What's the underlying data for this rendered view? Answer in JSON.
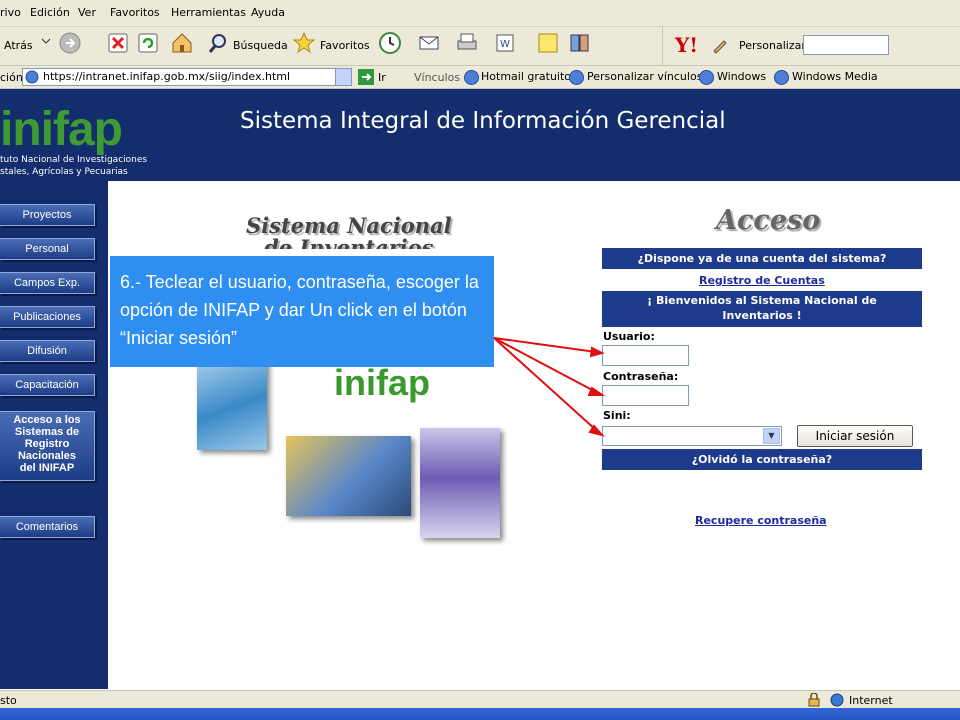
{
  "menu": [
    "rivo",
    "Edición",
    "Ver",
    "Favoritos",
    "Herramientas",
    "Ayuda"
  ],
  "toolbar": {
    "back": "Atrás",
    "search": "Búsqueda",
    "favorites": "Favoritos",
    "yahoo_personalize": "Personalizar"
  },
  "address": {
    "label": "ción",
    "url": "https://intranet.inifap.gob.mx/siig/index.html",
    "go": "Ir"
  },
  "links": {
    "label": "Vínculos",
    "items": [
      "Hotmail gratuito",
      "Personalizar vínculos",
      "Windows",
      "Windows Media"
    ]
  },
  "header": {
    "logo": "inifap",
    "logo_sub1": "tuto Nacional de Investigaciones",
    "logo_sub2": "stales, Agrícolas y Pecuarias",
    "title": "Sistema Integral de Información Gerencial"
  },
  "sidebar": {
    "items": [
      "Proyectos",
      "Personal",
      "Campos Exp.",
      "Publicaciones",
      "Difusión",
      "Capacitación",
      "Acceso a los\nSistemas de\nRegistro\nNacionales\ndel INIFAP",
      "Comentarios"
    ]
  },
  "main": {
    "sn_title_line1": "Sistema Nacional",
    "sn_title_line2": "de Inventarios",
    "collage_logo": "inifap"
  },
  "login": {
    "title": "Acceso",
    "bar_account": "¿Dispone ya de una cuenta del sistema?",
    "register_link": "Registro de Cuentas",
    "welcome": "¡ Bienvenidos al Sistema Nacional de Inventarios !",
    "user_label": "Usuario:",
    "password_label": "Contraseña:",
    "sini_label": "Sini:",
    "submit": "Iniciar sesión",
    "forgot_bar": "¿Olvidó la contraseña?",
    "recover_link": "Recupere contraseña"
  },
  "callout": {
    "text": "6.- Teclear el usuario, contraseña, escoger la opción de INIFAP y dar Un click en el botón “Iniciar sesión”"
  },
  "status": {
    "left": "sto",
    "zone": "Internet"
  },
  "colors": {
    "header_bg": "#132d6d",
    "bar_bg": "#1e3a8a",
    "callout_bg": "#2f8ff0",
    "logo_green": "#3f9a35",
    "arrow_red": "#e01010"
  }
}
